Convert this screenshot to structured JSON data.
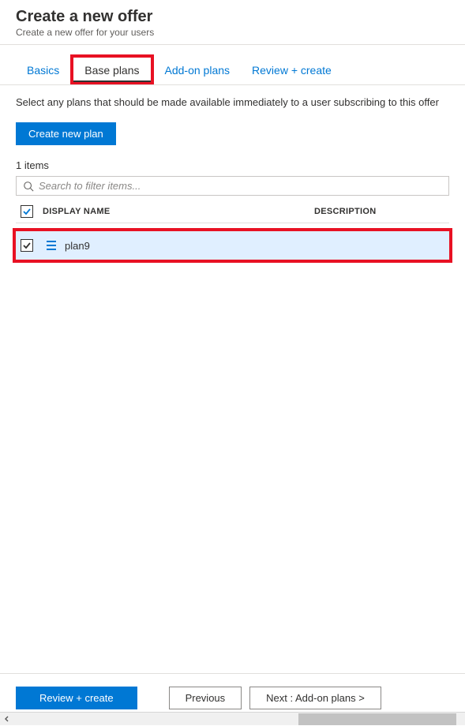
{
  "header": {
    "title": "Create a new offer",
    "subtitle": "Create a new offer for your users"
  },
  "tabs": {
    "basics": "Basics",
    "base_plans": "Base plans",
    "addon_plans": "Add-on plans",
    "review_create": "Review + create"
  },
  "content": {
    "description": "Select any plans that should be made available immediately to a user subscribing to this offer",
    "create_new_plan": "Create new plan",
    "item_count": "1 items",
    "search_placeholder": "Search to filter items..."
  },
  "columns": {
    "display_name": "DISPLAY NAME",
    "description": "DESCRIPTION"
  },
  "rows": [
    {
      "name": "plan9",
      "description": ""
    }
  ],
  "footer": {
    "review_create": "Review + create",
    "previous": "Previous",
    "next": "Next : Add-on plans >"
  }
}
